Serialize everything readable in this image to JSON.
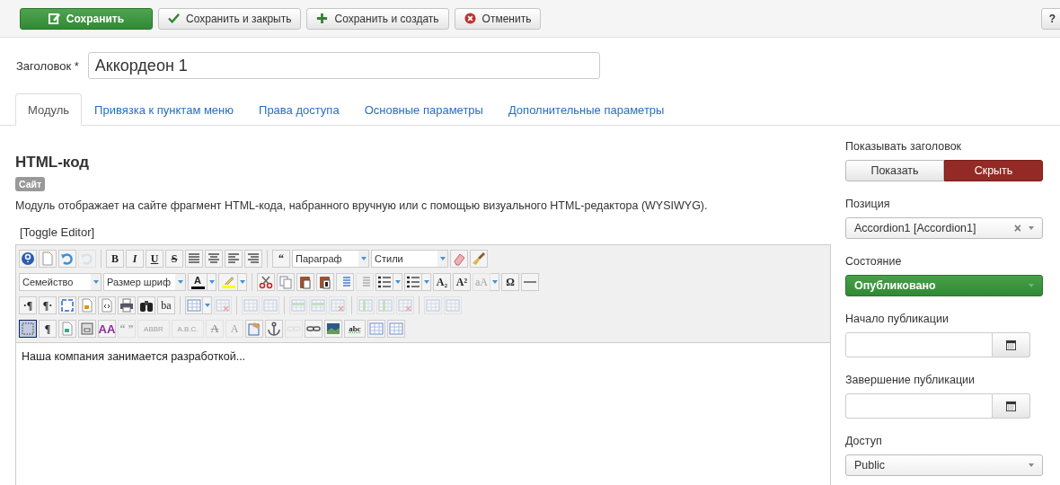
{
  "toolbar": {
    "buttons": [
      {
        "kind": "primary",
        "label": "Сохранить"
      },
      {
        "kind": "check",
        "label": "Сохранить и закрыть"
      },
      {
        "kind": "plus",
        "label": "Сохранить и создать"
      },
      {
        "kind": "cancel",
        "label": "Отменить"
      }
    ],
    "help_button": {
      "label": "?"
    }
  },
  "title_field": {
    "label": "Заголовок *",
    "value": "Аккордеон 1"
  },
  "tabs": [
    {
      "label": "Модуль",
      "selected": true
    },
    {
      "label": "Привязка к пунктам меню",
      "selected": false
    },
    {
      "label": "Права доступа",
      "selected": false
    },
    {
      "label": "Основные параметры",
      "selected": false
    },
    {
      "label": "Дополнительные параметры",
      "selected": false
    }
  ],
  "module": {
    "heading": "HTML-код",
    "badge": "Сайт",
    "description": "Модуль отображает на сайте фрагмент HTML-кода, набранного вручную или с помощью визуального HTML-редактора (WYSIWYG).",
    "toggle_editor": "[Toggle Editor]"
  },
  "editor": {
    "toolbar_rows": [
      [
        {
          "kind": "icon",
          "disabled": false,
          "pressed": false
        },
        {
          "kind": "icon",
          "disabled": false,
          "pressed": false
        },
        {
          "kind": "icon",
          "disabled": false,
          "pressed": false
        },
        {
          "kind": "icon",
          "disabled": true,
          "pressed": false
        },
        {
          "kind": "sep"
        },
        {
          "kind": "bold",
          "text": "B",
          "disabled": false,
          "pressed": false
        },
        {
          "kind": "italic",
          "text": "I",
          "disabled": false,
          "pressed": false
        },
        {
          "kind": "underline",
          "text": "U",
          "disabled": false,
          "pressed": false
        },
        {
          "kind": "strike",
          "text": "S",
          "disabled": false,
          "pressed": false
        },
        {
          "kind": "icon",
          "disabled": false,
          "pressed": false
        },
        {
          "kind": "icon",
          "disabled": false,
          "pressed": false
        },
        {
          "kind": "icon",
          "disabled": false,
          "pressed": false
        },
        {
          "kind": "icon",
          "disabled": false,
          "pressed": false
        },
        {
          "kind": "sep"
        },
        {
          "kind": "bold",
          "text": "“",
          "disabled": false,
          "pressed": false
        },
        {
          "kind": "select",
          "value": "Параграф"
        },
        {
          "kind": "select",
          "value": "Стили"
        },
        {
          "kind": "icon",
          "disabled": false,
          "pressed": false
        },
        {
          "kind": "icon",
          "disabled": false,
          "pressed": false
        }
      ],
      [
        {
          "kind": "select",
          "value": "Семейство"
        },
        {
          "kind": "select",
          "value": "Размер шриф"
        },
        {
          "kind": "color",
          "text": "A",
          "color": "#000000",
          "disabled": false,
          "pressed": false
        },
        {
          "kind": "arrow"
        },
        {
          "kind": "color",
          "color": "#ffff00",
          "disabled": false,
          "pressed": false
        },
        {
          "kind": "arrow"
        },
        {
          "kind": "sep"
        },
        {
          "kind": "icon",
          "disabled": false,
          "pressed": false
        },
        {
          "kind": "icon",
          "disabled": false,
          "pressed": false
        },
        {
          "kind": "icon",
          "disabled": false,
          "pressed": false
        },
        {
          "kind": "icon",
          "disabled": false,
          "pressed": false
        },
        {
          "kind": "icon",
          "disabled": false,
          "pressed": false
        },
        {
          "kind": "icon",
          "disabled": true,
          "pressed": false
        },
        {
          "kind": "icon",
          "disabled": false,
          "pressed": false
        },
        {
          "kind": "arrow"
        },
        {
          "kind": "icon",
          "disabled": false,
          "pressed": false
        },
        {
          "kind": "arrow"
        },
        {
          "kind": "bold",
          "text": "A₂",
          "disabled": false,
          "pressed": false
        },
        {
          "kind": "bold",
          "text": "A²",
          "disabled": false,
          "pressed": false
        },
        {
          "kind": "plain",
          "text": "aA",
          "disabled": true,
          "pressed": false
        },
        {
          "kind": "arrow"
        },
        {
          "kind": "bold",
          "text": "Ω",
          "disabled": false,
          "pressed": false
        },
        {
          "kind": "icon",
          "disabled": false,
          "pressed": false
        }
      ],
      [
        {
          "kind": "bold",
          "text": "·¶",
          "disabled": false,
          "pressed": false
        },
        {
          "kind": "bold",
          "text": "¶·",
          "disabled": false,
          "pressed": false
        },
        {
          "kind": "icon",
          "disabled": false,
          "pressed": false
        },
        {
          "kind": "icon",
          "disabled": false,
          "pressed": false
        },
        {
          "kind": "icon",
          "disabled": false,
          "pressed": false
        },
        {
          "kind": "icon",
          "disabled": false,
          "pressed": false
        },
        {
          "kind": "icon",
          "disabled": false,
          "pressed": false
        },
        {
          "kind": "plain",
          "text": "ba",
          "disabled": false,
          "pressed": false
        },
        {
          "kind": "sep"
        },
        {
          "kind": "icon",
          "disabled": false,
          "pressed": false
        },
        {
          "kind": "arrow"
        },
        {
          "kind": "icon",
          "disabled": true,
          "pressed": false
        },
        {
          "kind": "sep"
        },
        {
          "kind": "icon",
          "disabled": true,
          "pressed": false
        },
        {
          "kind": "icon",
          "disabled": true,
          "pressed": false
        },
        {
          "kind": "sep"
        },
        {
          "kind": "icon",
          "disabled": true,
          "pressed": false
        },
        {
          "kind": "icon",
          "disabled": true,
          "pressed": false
        },
        {
          "kind": "icon",
          "disabled": true,
          "pressed": false
        },
        {
          "kind": "sep"
        },
        {
          "kind": "icon",
          "disabled": true,
          "pressed": false
        },
        {
          "kind": "icon",
          "disabled": true,
          "pressed": false
        },
        {
          "kind": "icon",
          "disabled": true,
          "pressed": false
        },
        {
          "kind": "sep"
        },
        {
          "kind": "icon",
          "disabled": true,
          "pressed": false
        },
        {
          "kind": "icon",
          "disabled": true,
          "pressed": false
        }
      ],
      [
        {
          "kind": "icon",
          "disabled": false,
          "pressed": true
        },
        {
          "kind": "bold",
          "text": "¶",
          "disabled": false,
          "pressed": false
        },
        {
          "kind": "icon",
          "disabled": false,
          "pressed": false
        },
        {
          "kind": "icon",
          "disabled": false,
          "pressed": false
        },
        {
          "kind": "styled",
          "text": "AA",
          "disabled": false,
          "pressed": false
        },
        {
          "kind": "bold",
          "text": "“ ”",
          "disabled": true,
          "pressed": false
        },
        {
          "kind": "tiny",
          "text": "ABBR",
          "disabled": true,
          "pressed": false
        },
        {
          "kind": "tiny",
          "text": "A.B.C.",
          "disabled": true,
          "pressed": false
        },
        {
          "kind": "strike",
          "text": "A",
          "disabled": true,
          "pressed": false
        },
        {
          "kind": "plain",
          "text": "A",
          "disabled": true,
          "pressed": false
        },
        {
          "kind": "icon",
          "disabled": false,
          "pressed": false
        },
        {
          "kind": "icon",
          "disabled": false,
          "pressed": false
        },
        {
          "kind": "icon",
          "disabled": true,
          "pressed": false
        },
        {
          "kind": "icon",
          "disabled": false,
          "pressed": false
        },
        {
          "kind": "icon",
          "disabled": false,
          "pressed": false
        },
        {
          "kind": "check",
          "text": "abc",
          "disabled": false,
          "pressed": false
        },
        {
          "kind": "icon",
          "disabled": false,
          "pressed": false
        },
        {
          "kind": "icon",
          "disabled": false,
          "pressed": false
        }
      ]
    ],
    "content": "Наша компания занимается разработкой..."
  },
  "sidebar": {
    "show_title": {
      "label": "Показывать заголовок",
      "options": [
        {
          "label": "Показать",
          "selected": false
        },
        {
          "label": "Скрыть",
          "selected": true
        }
      ]
    },
    "position": {
      "label": "Позиция",
      "value": "Accordion1 [Accordion1]",
      "clear": "×"
    },
    "state": {
      "label": "Состояние",
      "value": "Опубликовано"
    },
    "publish_up": {
      "label": "Начало публикации"
    },
    "publish_down": {
      "label": "Завершение публикации"
    },
    "access": {
      "label": "Доступ",
      "value": "Public"
    }
  }
}
